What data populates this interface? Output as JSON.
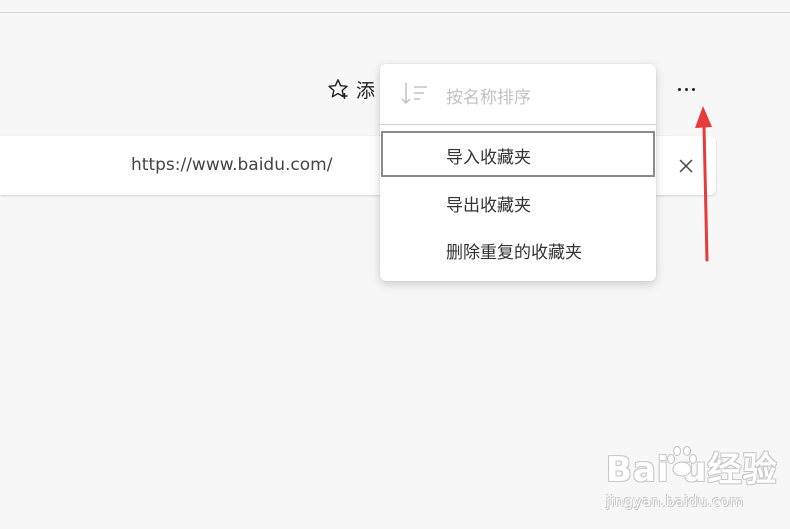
{
  "toolbar": {
    "add_favorite_label": "添"
  },
  "favorite_item": {
    "url": "https://www.baidu.com/"
  },
  "menu": {
    "sort_label": "按名称排序",
    "items": [
      {
        "label": "导入收藏夹"
      },
      {
        "label": "导出收藏夹"
      },
      {
        "label": "删除重复的收藏夹"
      }
    ]
  },
  "watermark": {
    "brand": "Bai  u经验",
    "sub": "jingyan.baidu.com"
  },
  "colors": {
    "background": "#f7f7f7",
    "menu_bg": "#ffffff",
    "focus_border": "#8a8a8a",
    "disabled_text": "#c2c2c2",
    "annotation_red": "#e83a3a"
  }
}
